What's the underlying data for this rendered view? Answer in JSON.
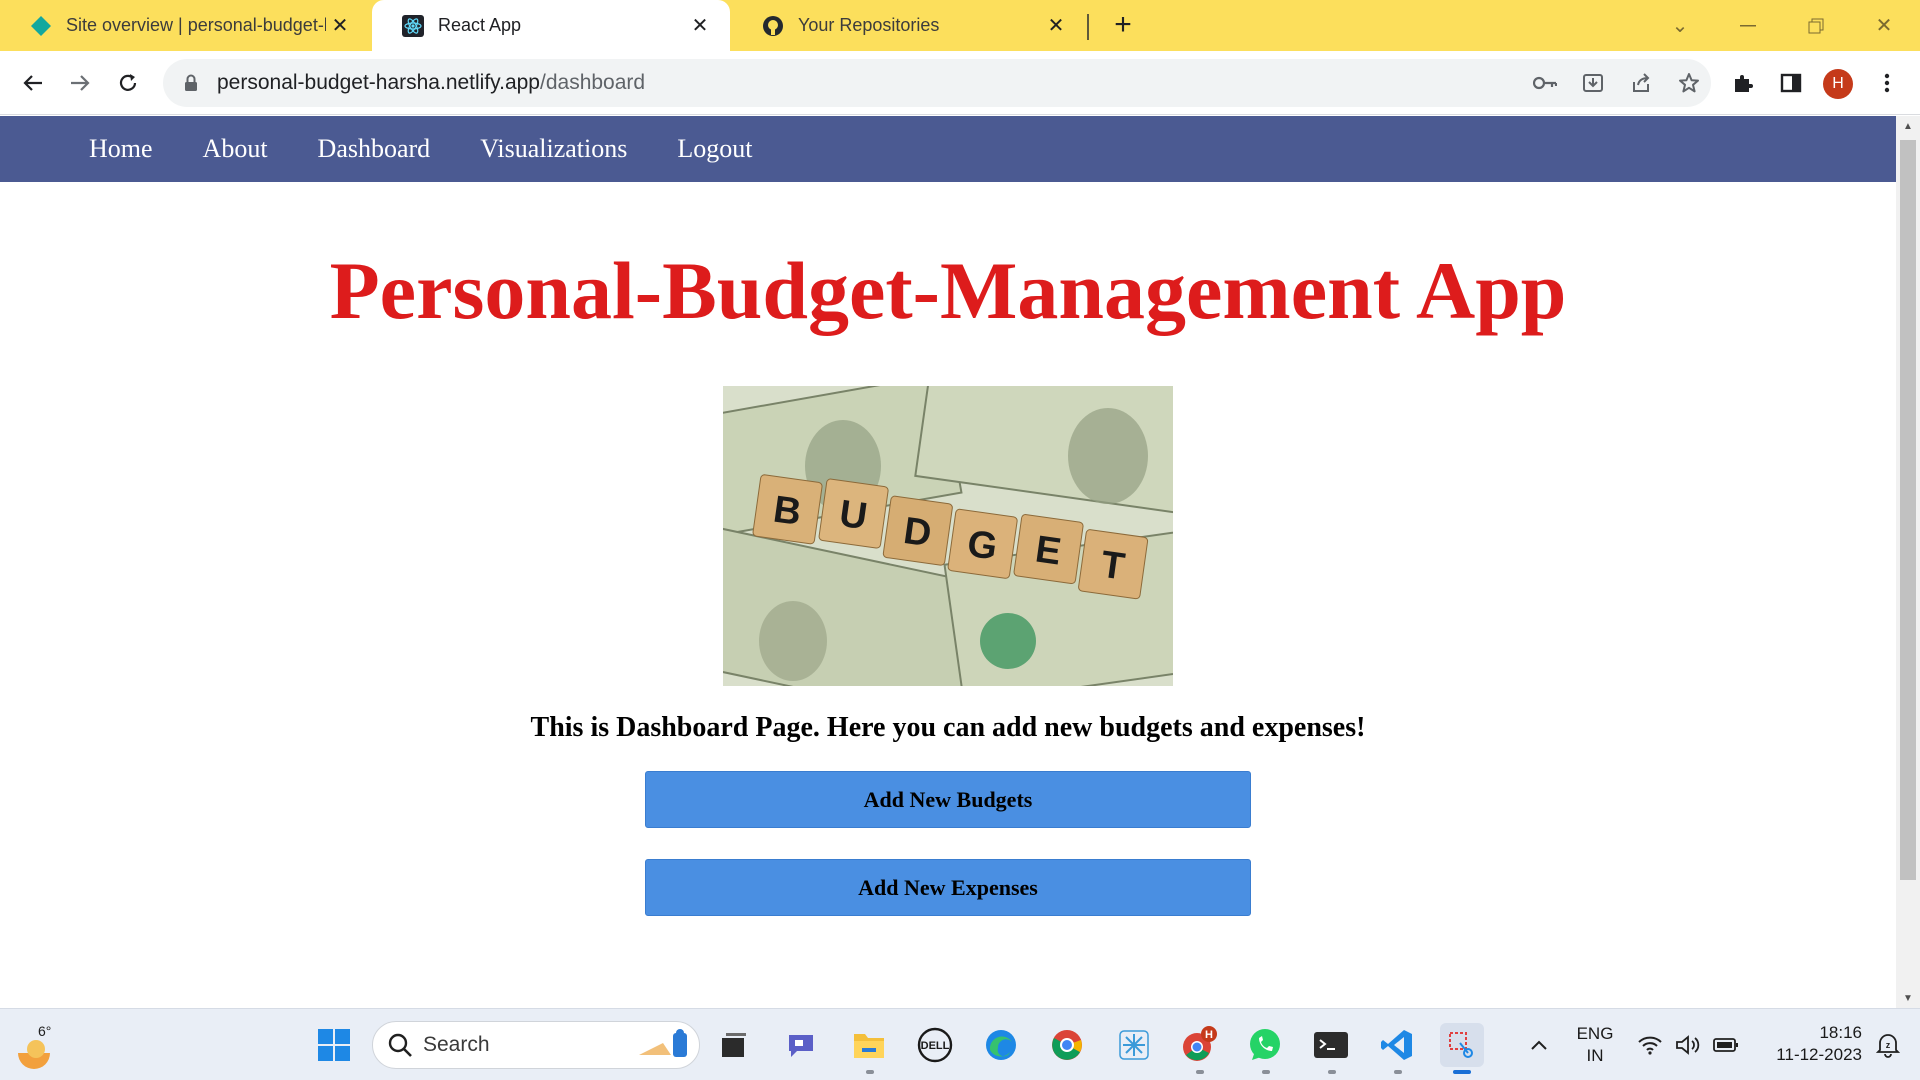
{
  "browser": {
    "tabs": [
      {
        "title": "Site overview | personal-budget-harsha",
        "active": false,
        "icon": "netlify-diamond-icon"
      },
      {
        "title": "React App",
        "active": true,
        "icon": "react-atom-icon"
      },
      {
        "title": "Your Repositories",
        "active": false,
        "icon": "github-octocat-icon"
      }
    ],
    "url_host": "personal-budget-harsha.netlify.app",
    "url_path": "/dashboard",
    "profile_initial": "H"
  },
  "site": {
    "nav": [
      "Home",
      "About",
      "Dashboard",
      "Visualizations",
      "Logout"
    ],
    "heading": "Personal-Budget-Management App",
    "image_letters": [
      "B",
      "U",
      "D",
      "G",
      "E",
      "T"
    ],
    "caption": "This is Dashboard Page. Here you can add new budgets and expenses!",
    "buttons": {
      "add_budgets": "Add New Budgets",
      "add_expenses": "Add New Expenses"
    }
  },
  "taskbar": {
    "weather_temp": "6°",
    "search_label": "Search",
    "chrome_badge": "H",
    "language": "ENG",
    "region": "IN",
    "time": "18:16",
    "date": "11-12-2023"
  },
  "colors": {
    "tabstrip": "#fcdf5c",
    "nav_bg": "#4b5a92",
    "heading": "#dd1c1c",
    "button_bg": "#4a8fe2"
  }
}
